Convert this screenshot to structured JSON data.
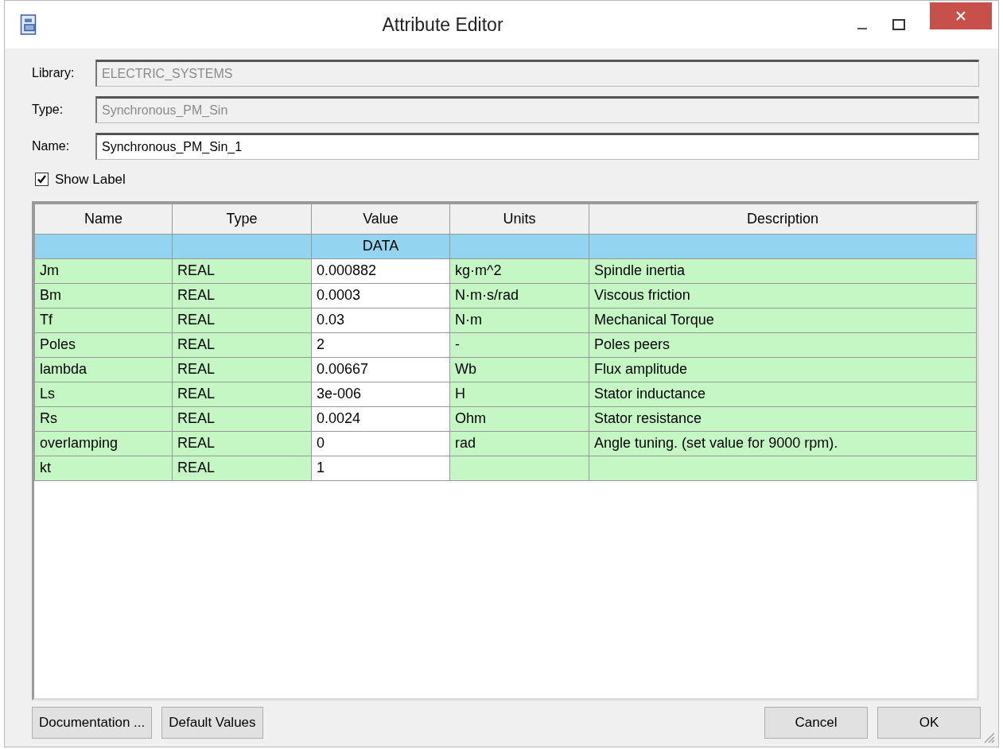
{
  "window": {
    "title": "Attribute Editor"
  },
  "fields": [
    {
      "label": "Library:",
      "value": "ELECTRIC_SYSTEMS",
      "disabled": true
    },
    {
      "label": "Type:",
      "value": "Synchronous_PM_Sin",
      "disabled": true
    },
    {
      "label": "Name:",
      "value": "Synchronous_PM_Sin_1",
      "disabled": false
    }
  ],
  "show_label": {
    "label": "Show Label",
    "checked": true
  },
  "table": {
    "columns": [
      "Name",
      "Type",
      "Value",
      "Units",
      "Description"
    ],
    "rows": [
      {
        "kind": "group",
        "cells": [
          "",
          "",
          "DATA",
          "",
          ""
        ]
      },
      {
        "kind": "param",
        "cells": [
          "Jm",
          "REAL",
          "0.000882",
          "kg·m^2",
          "Spindle inertia"
        ]
      },
      {
        "kind": "param",
        "cells": [
          "Bm",
          "REAL",
          "0.0003",
          "N·m·s/rad",
          "Viscous friction"
        ]
      },
      {
        "kind": "param",
        "cells": [
          "Tf",
          "REAL",
          "0.03",
          "N·m",
          "Mechanical Torque"
        ]
      },
      {
        "kind": "param",
        "cells": [
          "Poles",
          "REAL",
          "2",
          "-",
          "Poles peers"
        ]
      },
      {
        "kind": "param",
        "cells": [
          "lambda",
          "REAL",
          "0.00667",
          "Wb",
          "Flux amplitude"
        ]
      },
      {
        "kind": "param",
        "cells": [
          "Ls",
          "REAL",
          "3e-006",
          "H",
          "Stator inductance"
        ]
      },
      {
        "kind": "param",
        "cells": [
          "Rs",
          "REAL",
          "0.0024",
          "Ohm",
          "Stator resistance"
        ]
      },
      {
        "kind": "param",
        "cells": [
          "overlamping",
          "REAL",
          "0",
          "rad",
          "Angle tuning. (set value for 9000 rpm)."
        ]
      },
      {
        "kind": "param",
        "cells": [
          "kt",
          "REAL",
          "1",
          "",
          ""
        ]
      }
    ]
  },
  "buttons_left": [
    "Documentation ...",
    "Default Values"
  ],
  "buttons_right": [
    "Cancel",
    "OK"
  ]
}
